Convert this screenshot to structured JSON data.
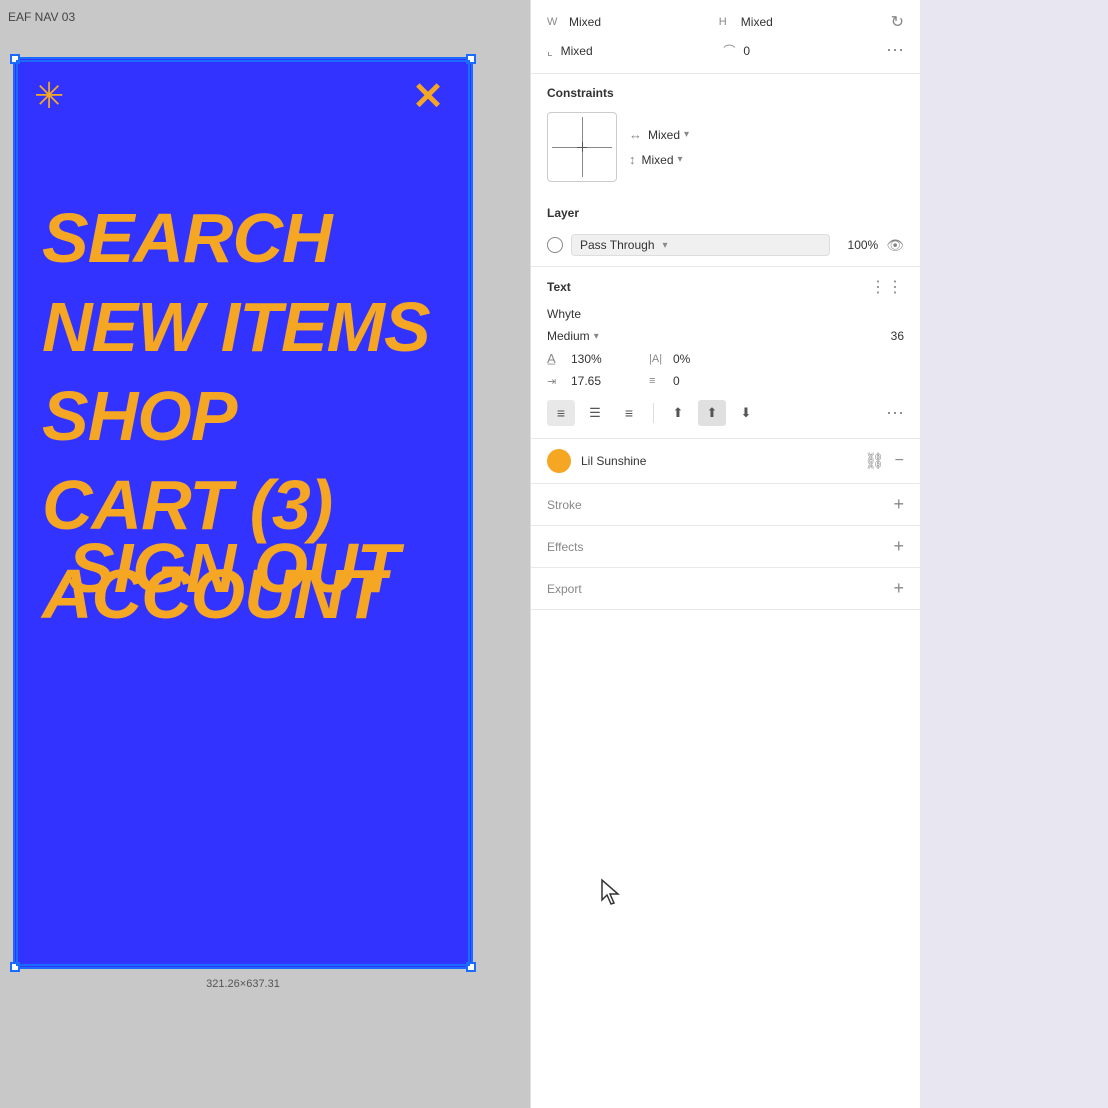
{
  "frame": {
    "label": "EAF NAV 03",
    "dimensions": "321.26×637.31"
  },
  "nav": {
    "items": [
      {
        "label": "SEARCH"
      },
      {
        "label": "NEW ITEMS"
      },
      {
        "label": "SHOP"
      },
      {
        "label": "CART (3)"
      },
      {
        "label": "ACCOUNT"
      },
      {
        "label": "SIGN OUT"
      }
    ]
  },
  "properties": {
    "width_label": "W",
    "width_value": "Mixed",
    "height_label": "H",
    "height_value": "Mixed",
    "rotation_label": "↻",
    "border_radius_label": "⌒",
    "border_radius_value": "0",
    "mixed_label": "Mixed",
    "constraints_section": "Constraints",
    "constraints_h": "Mixed",
    "constraints_v": "Mixed",
    "layer_section": "Layer",
    "layer_mode": "Pass Through",
    "layer_opacity": "100%",
    "text_section": "Text",
    "font_family": "Whyte",
    "font_weight": "Medium",
    "font_size": "36",
    "line_height": "130%",
    "letter_spacing": "0%",
    "baseline_value": "17.65",
    "paragraph_spacing": "0",
    "fill_name": "Lil Sunshine",
    "stroke_label": "Stroke",
    "effects_label": "Effects",
    "export_label": "Export"
  }
}
